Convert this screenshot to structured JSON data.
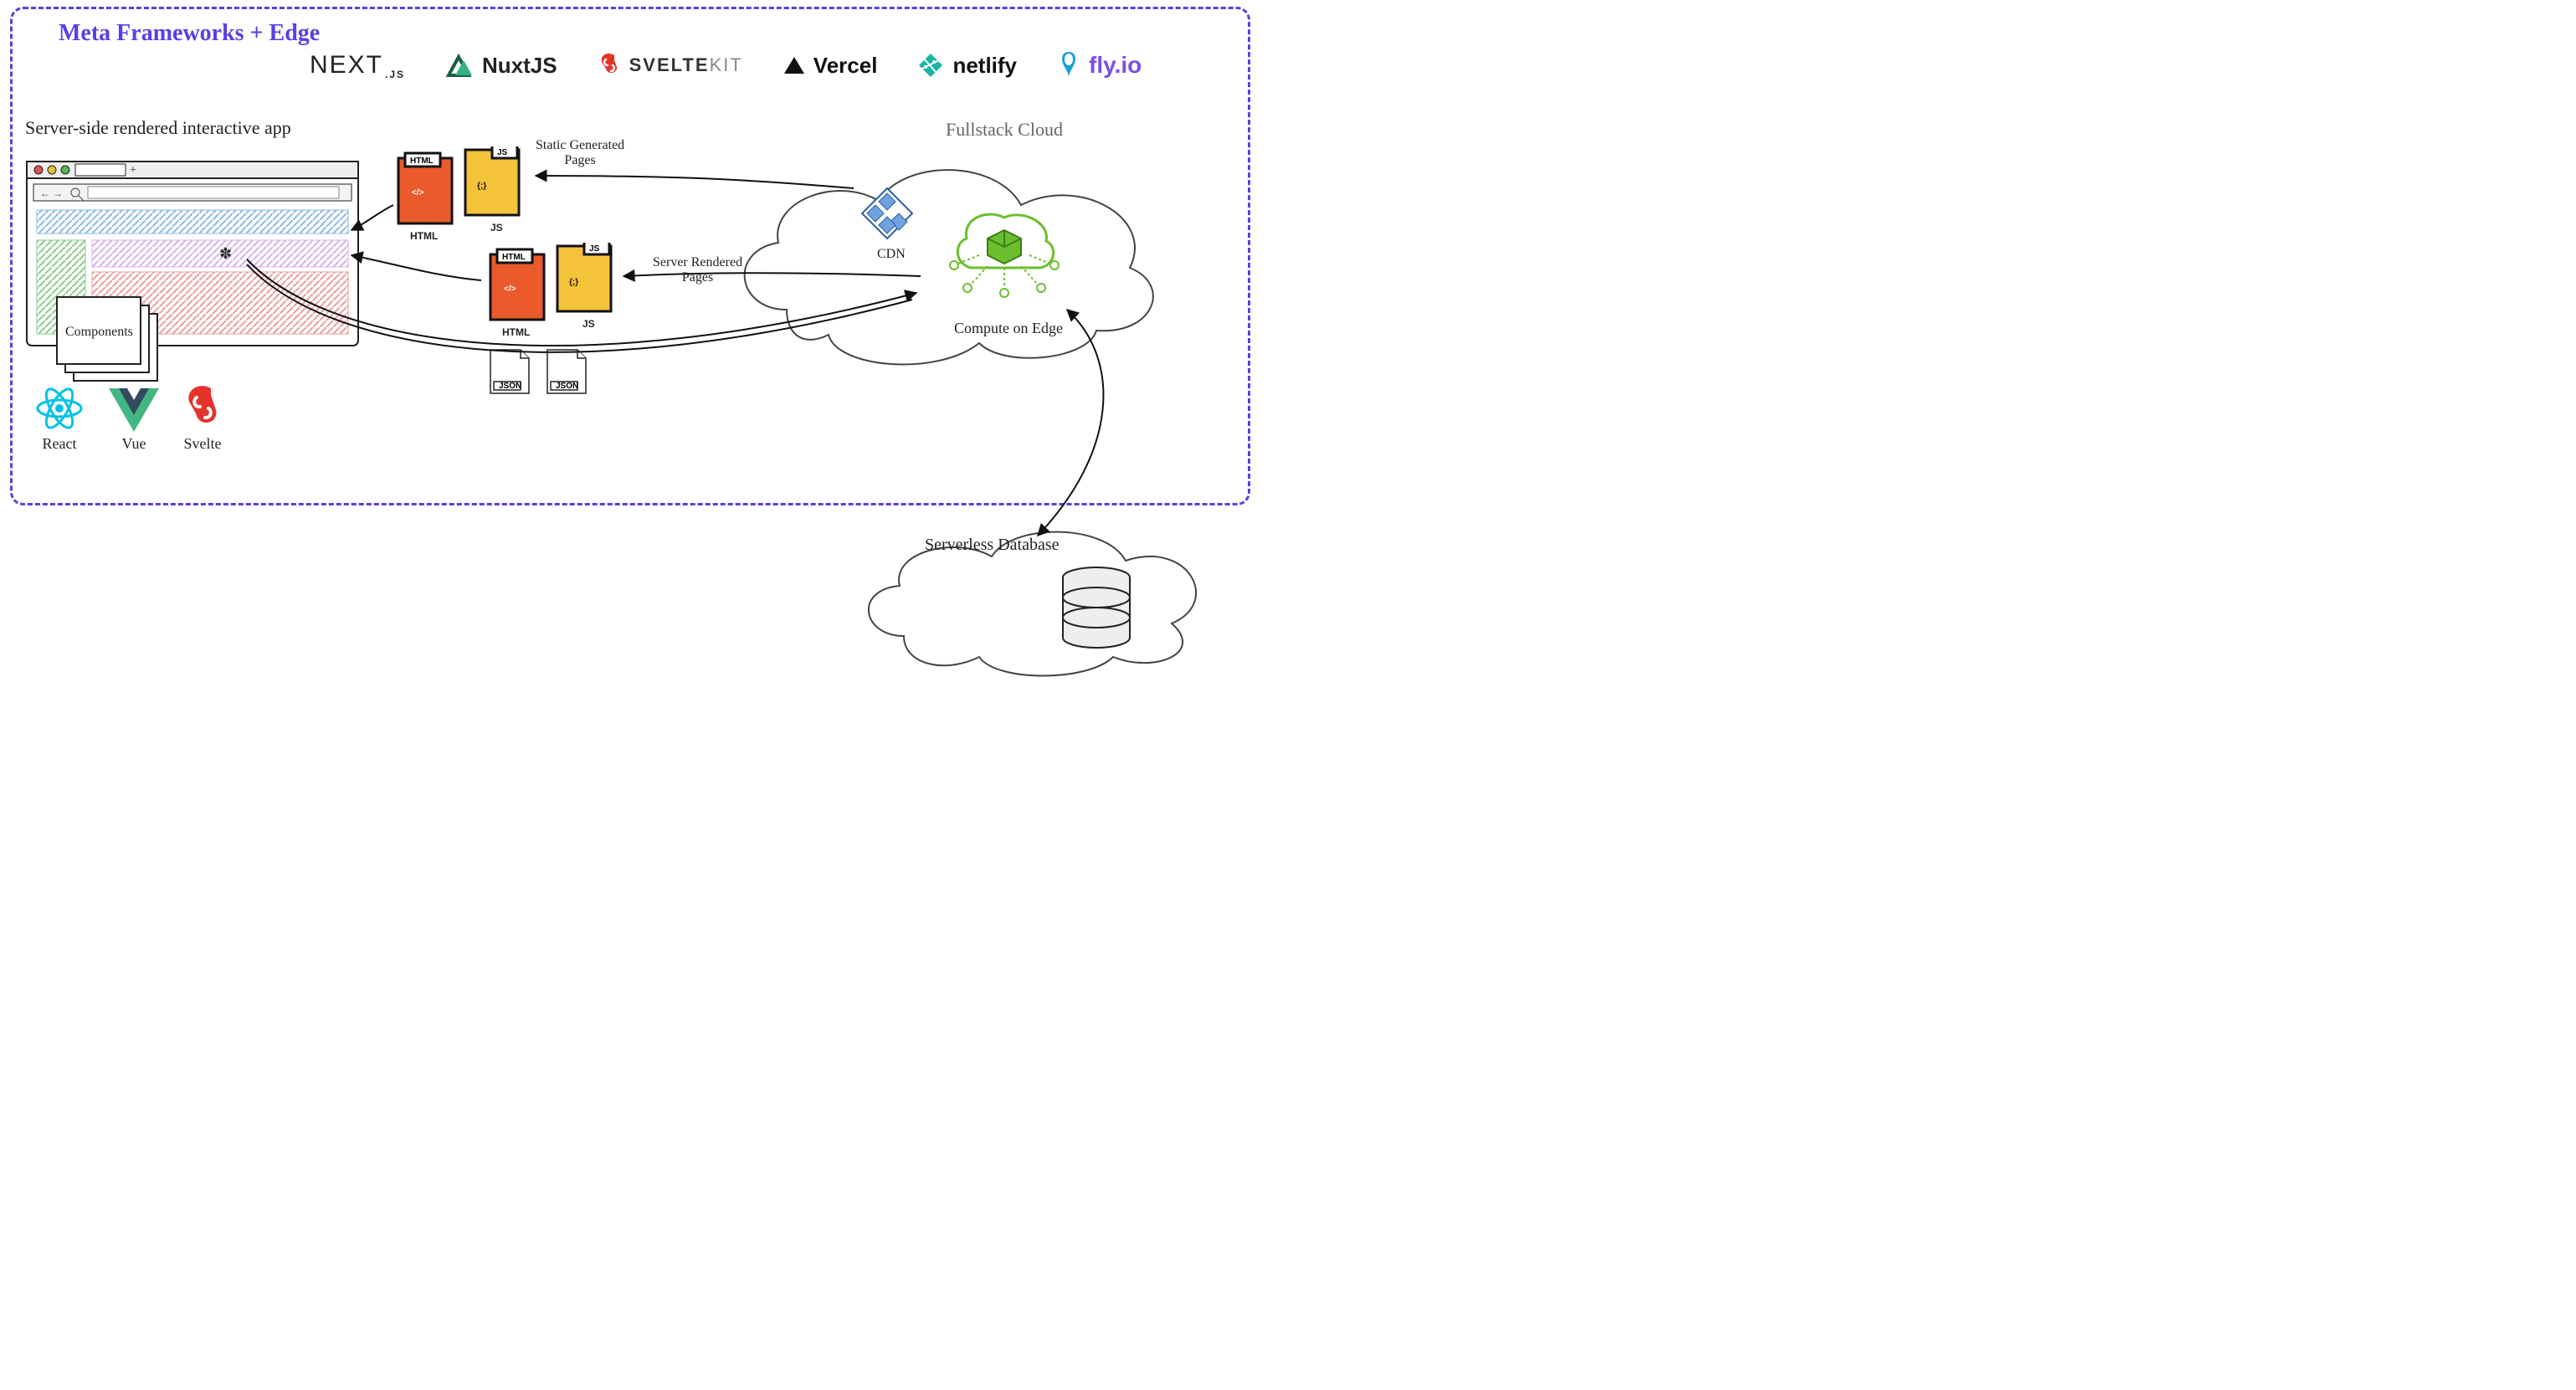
{
  "title": "Meta Frameworks + Edge",
  "brands": {
    "next": "NEXT",
    "next_sub": ".JS",
    "nuxt": "NuxtJS",
    "sveltekit1": "SVELTE",
    "sveltekit2": "KIT",
    "vercel": "Vercel",
    "netlify": "netlify",
    "flyio": "fly.io"
  },
  "labels": {
    "ssr": "Server-side rendered interactive app",
    "fullstack": "Fullstack Cloud",
    "components": "Components",
    "cdn": "CDN",
    "compute": "Compute on Edge",
    "serverless_db": "Serverless Database",
    "static_pages": "Static Generated\nPages",
    "server_pages": "Server Rendered\nPages",
    "html_caption": "HTML",
    "js_caption": "JS",
    "json_caption": "JSON"
  },
  "file_badges": {
    "html": "HTML",
    "js": "JS",
    "json": "JSON"
  },
  "tech": {
    "react": "React",
    "vue": "Vue",
    "svelte": "Svelte"
  },
  "colors": {
    "border": "#5B3EE6",
    "html_file": "#EA5A2A",
    "js_file": "#F4C33A",
    "nuxt_green": "#35B27F",
    "svelte": "#E6332A",
    "vue": "#41B883",
    "react": "#00C2E6",
    "netlify": "#19B5A5",
    "fly_purple": "#7B4DEB",
    "edge_green": "#6BBE2E"
  }
}
